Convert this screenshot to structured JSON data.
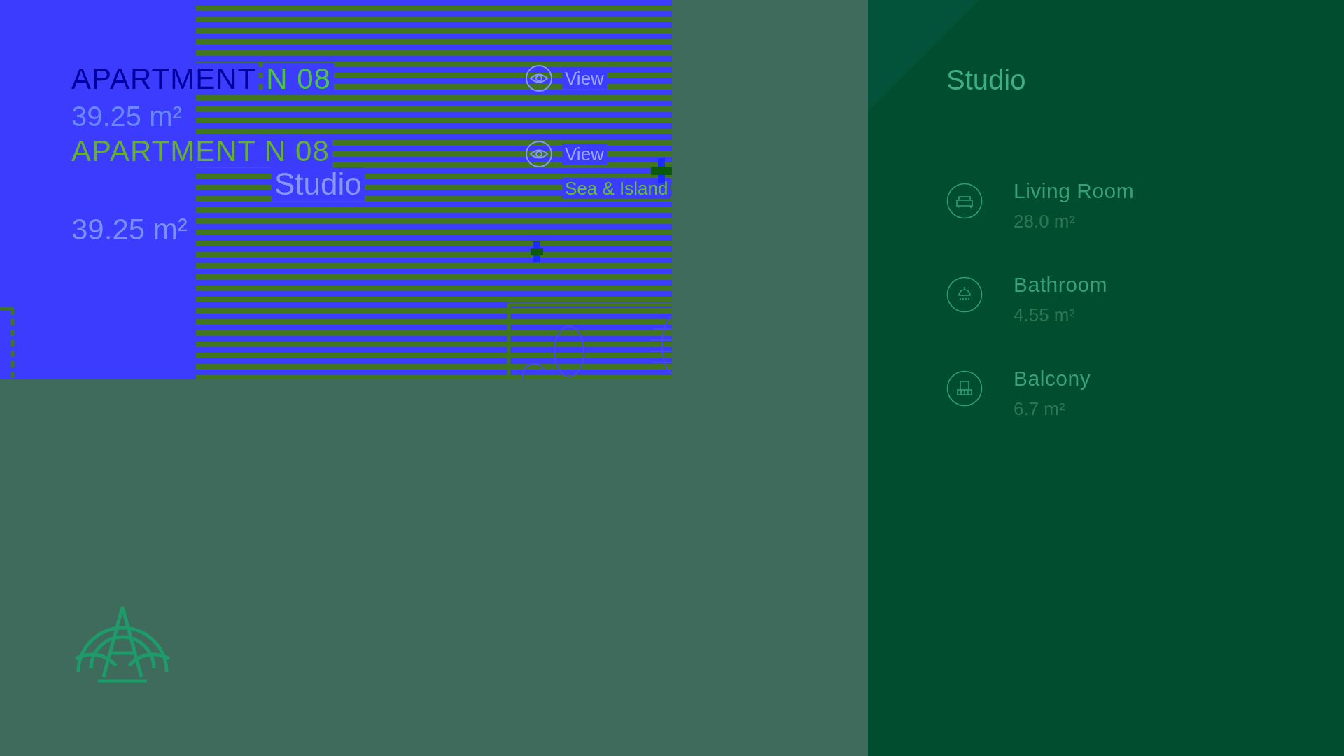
{
  "header": {
    "title": "APARTMENT",
    "number": "N 08",
    "area": "39.25 m²"
  },
  "ghost_text": {
    "title": "APARTMENT N 08",
    "type": "Studio",
    "area": "39.25 m²"
  },
  "plan": {
    "view_labels": [
      "View",
      "View"
    ],
    "orientation": "Sea & Island"
  },
  "panel": {
    "title": "Studio",
    "rooms": [
      {
        "kind": "sofa",
        "name": "Living Room",
        "area": "28.0 m²"
      },
      {
        "kind": "shower",
        "name": "Bathroom",
        "area": "4.55 m²"
      },
      {
        "kind": "railing",
        "name": "Balcony",
        "area": "6.7 m²"
      }
    ]
  }
}
